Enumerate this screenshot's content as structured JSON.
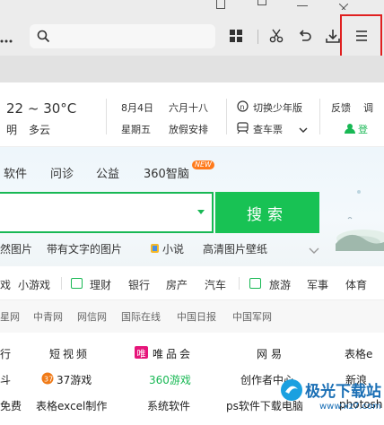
{
  "toolbar": {
    "menu_icon": "hamburger-menu-icon",
    "address_icon": "search-icon",
    "tools": [
      "grid-icon",
      "scissors-icon",
      "undo-icon",
      "download-icon"
    ]
  },
  "info": {
    "temperature": "22 ~ 30°C",
    "weather_left": "明",
    "weather": "多云",
    "date": "8月4日",
    "lunar": "六月十八",
    "weekday": "星期五",
    "holiday": "放假安排",
    "youth_mode": "切换少年版",
    "train": "查车票",
    "feedback": "反馈",
    "adjust": "调",
    "login": "登"
  },
  "nav": {
    "tabs": [
      "软件",
      "问诊",
      "公益",
      "360智脑"
    ],
    "new_badge": "NEW"
  },
  "search": {
    "button": "搜索",
    "hot": [
      "然图片",
      "带有文字的图片",
      "小说",
      "高清图片壁纸"
    ]
  },
  "categories": [
    "戏",
    "小游戏",
    "理财",
    "银行",
    "房产",
    "汽车",
    "旅游",
    "军事",
    "体育"
  ],
  "news_sites": [
    "星网",
    "中青网",
    "网信网",
    "国际在线",
    "中国日报",
    "中国军网"
  ],
  "links": {
    "row1": [
      "行",
      "短视频",
      "唯品会",
      "网易",
      "表格e"
    ],
    "row1_badge": "唯",
    "row2": [
      "斗",
      "37游戏",
      "360游戏",
      "创作者中心",
      "新浪"
    ],
    "row3": [
      "免费",
      "表格excel制作",
      "系统软件",
      "ps软件下载电脑",
      "photosh"
    ]
  },
  "watermark": {
    "title": "极光下载站",
    "url": "www.xz7.com"
  }
}
